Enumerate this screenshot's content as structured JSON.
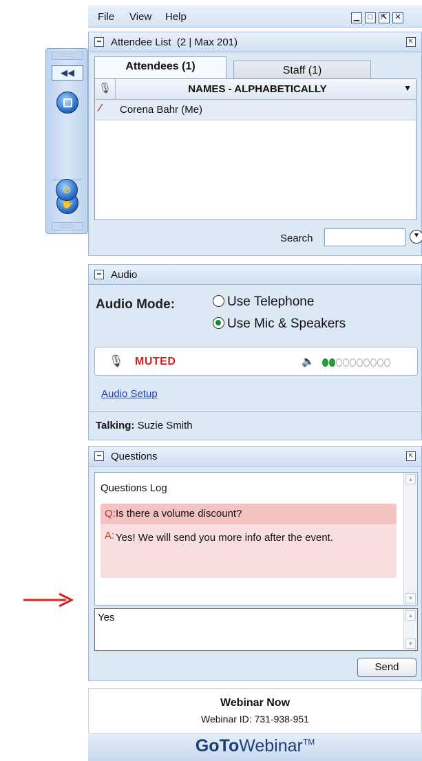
{
  "menu": {
    "items": [
      "File",
      "View",
      "Help"
    ]
  },
  "window_controls": {
    "minimize": "▁",
    "restore": "□",
    "popout": "⇱",
    "close": "✕"
  },
  "floating_toolbar": {
    "grip_top": "::::::",
    "collapse": "◀◀",
    "grip_bottom": "::::::"
  },
  "attendee_list": {
    "title": "Attendee List",
    "count": "(2 | Max 201)",
    "tabs": {
      "attendees": "Attendees (1)",
      "staff": "Staff (1)"
    },
    "column_header": "NAMES - ALPHABETICALLY",
    "rows": [
      {
        "name": "Corena Bahr (Me)"
      }
    ],
    "search_label": "Search",
    "search_value": ""
  },
  "audio": {
    "title": "Audio",
    "mode_label": "Audio Mode:",
    "options": {
      "telephone": "Use Telephone",
      "mic": "Use Mic & Speakers"
    },
    "selected": "mic",
    "status": "MUTED",
    "level": {
      "on": 2,
      "total": 10
    },
    "setup_link": "Audio Setup",
    "talking_label": "Talking:",
    "talking_name": "Suzie Smith"
  },
  "questions": {
    "title": "Questions",
    "log_title": "Questions Log",
    "q_prefix": "Q:",
    "question": "Is there a volume discount?",
    "a_prefix": "A:",
    "answer": "Yes! We will send you more info after the event.",
    "reply_value": "Yes",
    "send_label": "Send"
  },
  "footer": {
    "title": "Webinar Now",
    "webinar_id": "Webinar ID: 731-938-951",
    "brand_bold": "GoTo",
    "brand_light": "Webinar",
    "brand_tm": "TM"
  },
  "colors": {
    "accent": "#1c3f7a",
    "muted": "#d21f1f",
    "panel_bg": "#dde8f5",
    "arrow": "#e02020"
  }
}
